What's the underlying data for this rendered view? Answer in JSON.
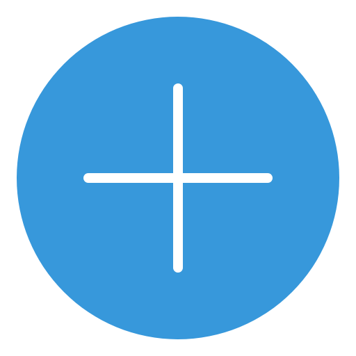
{
  "button": {
    "icon": "plus-icon",
    "background_color": "#3798DB",
    "icon_color": "#FFFFFF",
    "page_background": "#FFFFFF"
  }
}
